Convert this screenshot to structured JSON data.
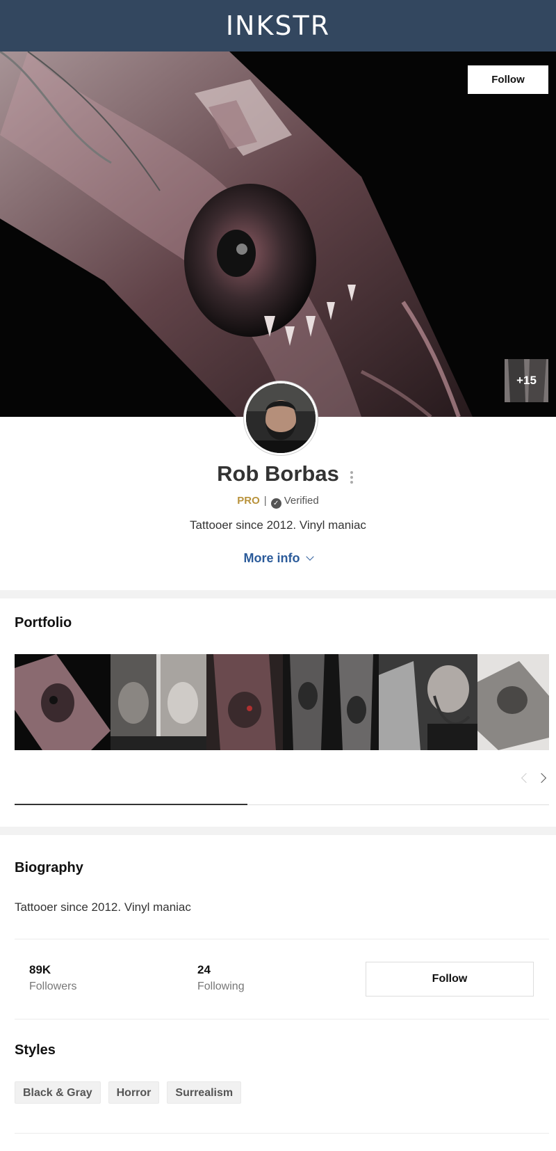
{
  "header": {
    "brand": "INKSTR"
  },
  "hero": {
    "follow_label": "Follow",
    "more_photos_label": "+15"
  },
  "profile": {
    "name": "Rob Borbas",
    "pro_label": "PRO",
    "separator": "|",
    "verified_label": "Verified",
    "tagline": "Tattooer since 2012. Vinyl maniac",
    "more_info_label": "More info"
  },
  "portfolio": {
    "title": "Portfolio",
    "thumb_count": 6,
    "scroll_fraction": 0.44
  },
  "biography": {
    "title": "Biography",
    "text": "Tattooer since 2012. Vinyl maniac"
  },
  "stats": {
    "followers_value": "89K",
    "followers_label": "Followers",
    "following_value": "24",
    "following_label": "Following",
    "follow_label": "Follow"
  },
  "styles": {
    "title": "Styles",
    "tags": [
      "Black & Gray",
      "Horror",
      "Surrealism"
    ]
  },
  "colors": {
    "header_bg": "#33475f",
    "pro": "#b8923b",
    "link": "#2b5b9a"
  }
}
